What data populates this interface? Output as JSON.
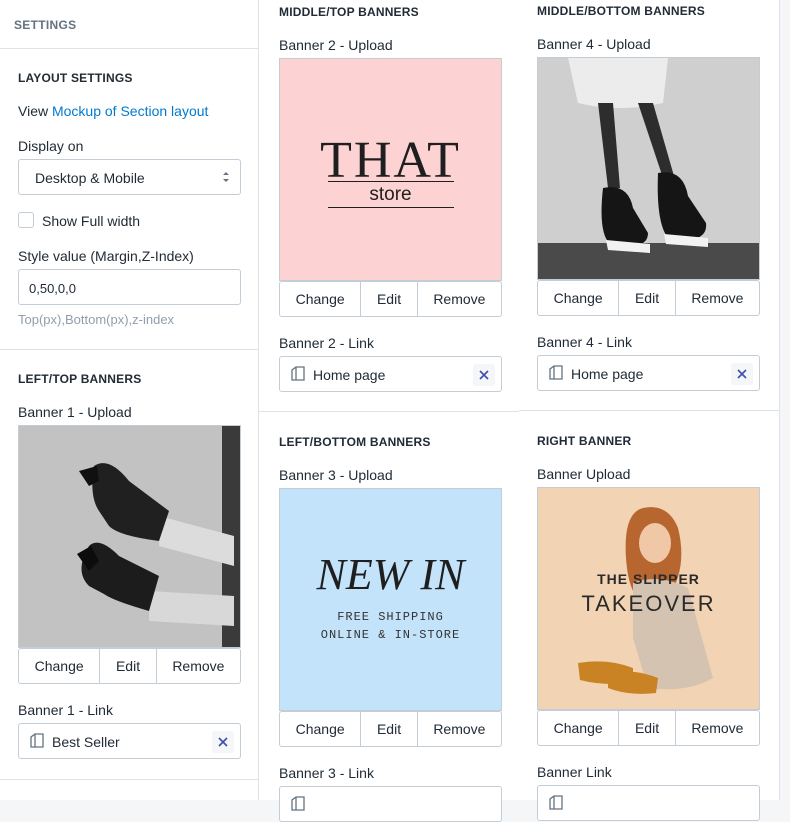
{
  "settings": {
    "title": "SETTINGS",
    "layout_title": "LAYOUT SETTINGS",
    "view_prefix": "View ",
    "view_link": "Mockup of Section layout",
    "display_label": "Display on",
    "display_value": "Desktop & Mobile",
    "fullwidth_label": "Show Full width",
    "style_label": "Style value (Margin,Z-Index)",
    "style_value": "0,50,0,0",
    "style_help": "Top(px),Bottom(px),z-index"
  },
  "buttons": {
    "change": "Change",
    "edit": "Edit",
    "remove": "Remove"
  },
  "left_top": {
    "title": "LEFT/TOP BANNERS",
    "upload_label": "Banner 1 - Upload",
    "link_label": "Banner 1 - Link",
    "link_value": "Best Seller"
  },
  "middle_top": {
    "title": "MIDDLE/TOP BANNERS",
    "upload_label": "Banner 2 - Upload",
    "img_text1": "THAT",
    "img_text2": "store",
    "link_label": "Banner 2 - Link",
    "link_value": "Home page"
  },
  "left_bottom": {
    "title": "LEFT/BOTTOM BANNERS",
    "upload_label": "Banner 3 - Upload",
    "img_text1": "NEW IN",
    "img_text2": "FREE SHIPPING",
    "img_text3": "ONLINE & IN-STORE",
    "link_label": "Banner 3 - Link"
  },
  "middle_bottom": {
    "title": "MIDDLE/BOTTOM BANNERS",
    "upload_label": "Banner 4 - Upload",
    "link_label": "Banner 4 - Link",
    "link_value": "Home page"
  },
  "right_banner": {
    "title": "RIGHT BANNER",
    "upload_label": "Banner Upload",
    "img_text1": "THE SLIPPER",
    "img_text2": "TAKEOVER",
    "link_label": "Banner Link"
  },
  "colors": {
    "accent": "#007ace",
    "pink": "#fdd2d3",
    "lightblue": "#c3e3fb",
    "peach": "#f2d4b4"
  },
  "icons": [
    "chevron-updown-icon",
    "page-icon",
    "close-icon"
  ]
}
